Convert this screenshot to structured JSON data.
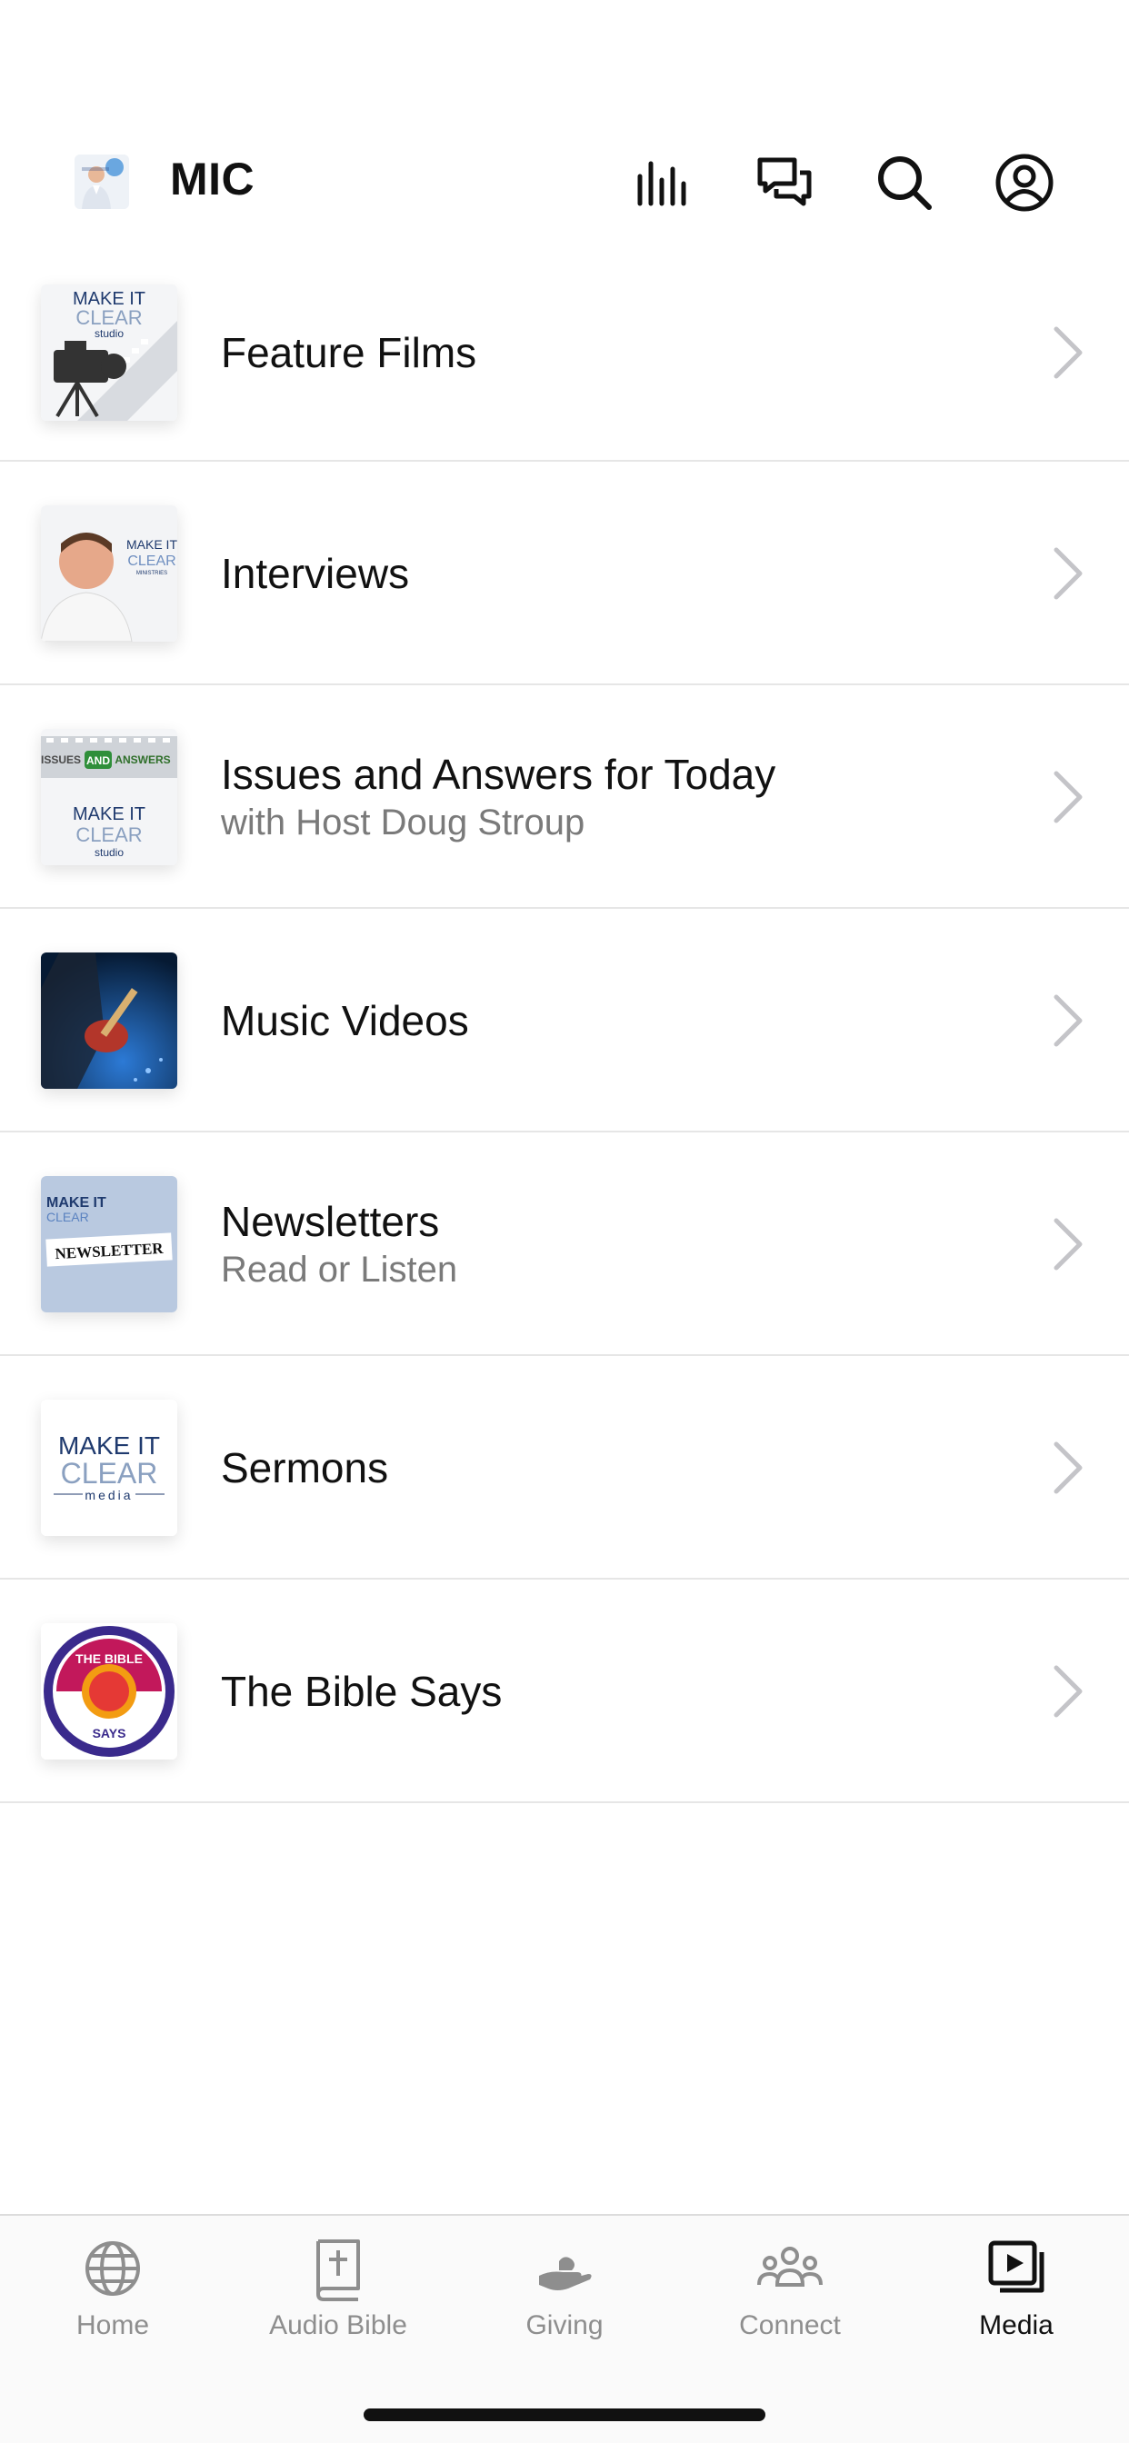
{
  "header": {
    "title": "MIC",
    "icons": [
      "equalizer-icon",
      "chat-icon",
      "search-icon",
      "account-icon"
    ]
  },
  "items": [
    {
      "label": "Feature Films",
      "subtitle": "",
      "thumb": "make-it-clear-studio-thumb"
    },
    {
      "label": "Interviews",
      "subtitle": "",
      "thumb": "interviews-thumb"
    },
    {
      "label": "Issues and Answers for Today",
      "subtitle": "with Host Doug Stroup",
      "thumb": "issues-and-answers-thumb"
    },
    {
      "label": "Music Videos",
      "subtitle": "",
      "thumb": "guitar-thumb"
    },
    {
      "label": "Newsletters",
      "subtitle": "Read or Listen",
      "thumb": "newsletter-thumb"
    },
    {
      "label": "Sermons",
      "subtitle": "",
      "thumb": "make-it-clear-media-thumb"
    },
    {
      "label": "The Bible Says",
      "subtitle": "",
      "thumb": "bible-says-thumb"
    }
  ],
  "tabs": [
    {
      "label": "Home",
      "icon": "globe-icon",
      "active": false
    },
    {
      "label": "Audio Bible",
      "icon": "bible-icon",
      "active": false
    },
    {
      "label": "Giving",
      "icon": "giving-hand-icon",
      "active": false
    },
    {
      "label": "Connect",
      "icon": "people-icon",
      "active": false
    },
    {
      "label": "Media",
      "icon": "media-icon",
      "active": true
    }
  ],
  "thumb_text": {
    "make_it": "MAKE IT",
    "clear": "CLEAR",
    "studio": "studio",
    "media": "media",
    "ministries": "MINISTRIES",
    "issues": "ISSUES",
    "and": "AND",
    "answers": "ANSWERS",
    "newsletter": "NEWSLETTER",
    "the_bible": "THE BIBLE",
    "says": "SAYS"
  },
  "colors": {
    "active": "#111111",
    "inactive": "#8e8e8e",
    "divider": "#e6e6e6",
    "chevron": "#c4c4c8",
    "brand_blue": "#1f3a6e"
  }
}
